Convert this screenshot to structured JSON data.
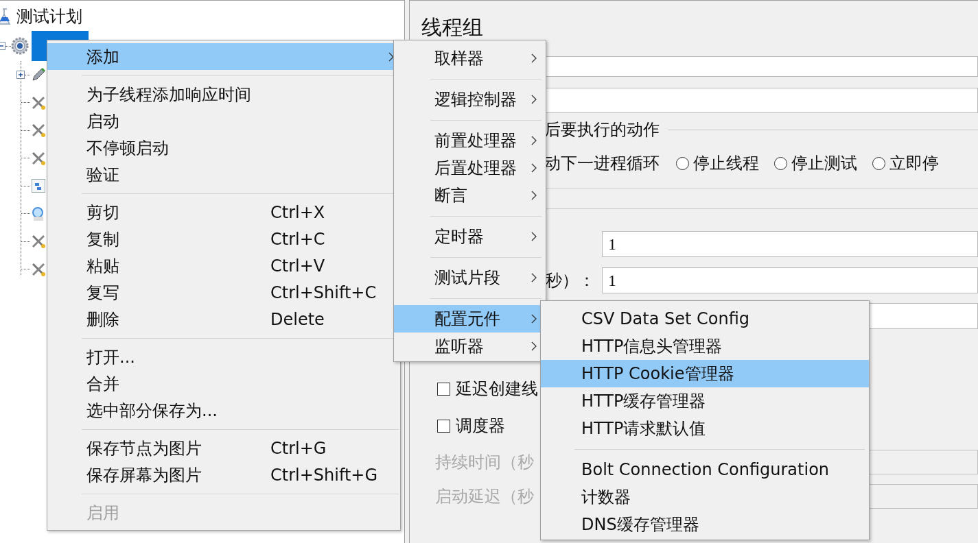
{
  "tree": {
    "root": {
      "label": "测试计划"
    },
    "node": {
      "selected": true,
      "expanded": true
    },
    "children": [
      {
        "kind": "script",
        "has_children": true
      },
      {
        "kind": "tool",
        "has_children": false
      },
      {
        "kind": "tool",
        "has_children": false
      },
      {
        "kind": "tool",
        "has_children": false
      },
      {
        "kind": "table",
        "has_children": false
      },
      {
        "kind": "magnifier",
        "has_children": false
      },
      {
        "kind": "tool",
        "has_children": false
      },
      {
        "kind": "tool",
        "has_children": false
      }
    ]
  },
  "panel": {
    "title": "线程组",
    "error_action": {
      "legend": "后要执行的动作",
      "cut_option_label": "动下一进程循环",
      "options": [
        {
          "label": "停止线程",
          "selected": false
        },
        {
          "label": "停止测试",
          "selected": false
        },
        {
          "label": "立即停",
          "selected": false
        }
      ]
    },
    "thread_fields": [
      {
        "value": "1"
      },
      {
        "label": "秒）：",
        "value": "1"
      }
    ],
    "checkboxes": [
      {
        "label": "延迟创建线",
        "checked": false
      },
      {
        "label": "调度器",
        "checked": false
      }
    ],
    "disabled_fields": [
      {
        "label": "持续时间（秒",
        "disabled": true
      },
      {
        "label": "启动延迟（秒",
        "disabled": true
      }
    ]
  },
  "context_menu": {
    "groups": [
      [
        {
          "label": "添加",
          "has_submenu": true,
          "selected": true,
          "disabled": false
        }
      ],
      [
        {
          "label": "为子线程添加响应时间",
          "selected": false,
          "disabled": false
        },
        {
          "label": "启动",
          "selected": false,
          "disabled": false
        },
        {
          "label": "不停顿启动",
          "selected": false,
          "disabled": false
        },
        {
          "label": "验证",
          "selected": false,
          "disabled": false
        }
      ],
      [
        {
          "label": "剪切",
          "shortcut": "Ctrl+X",
          "selected": false,
          "disabled": false
        },
        {
          "label": "复制",
          "shortcut": "Ctrl+C",
          "selected": false,
          "disabled": false
        },
        {
          "label": "粘贴",
          "shortcut": "Ctrl+V",
          "selected": false,
          "disabled": false
        },
        {
          "label": "复写",
          "shortcut": "Ctrl+Shift+C",
          "selected": false,
          "disabled": false
        },
        {
          "label": "删除",
          "shortcut": "Delete",
          "selected": false,
          "disabled": false
        }
      ],
      [
        {
          "label": "打开...",
          "selected": false,
          "disabled": false
        },
        {
          "label": "合并",
          "selected": false,
          "disabled": false
        },
        {
          "label": "选中部分保存为...",
          "selected": false,
          "disabled": false
        }
      ],
      [
        {
          "label": "保存节点为图片",
          "shortcut": "Ctrl+G",
          "selected": false,
          "disabled": false
        },
        {
          "label": "保存屏幕为图片",
          "shortcut": "Ctrl+Shift+G",
          "selected": false,
          "disabled": false
        }
      ],
      [
        {
          "label": "启用",
          "selected": false,
          "disabled": true
        }
      ]
    ]
  },
  "add_submenu": {
    "groups": [
      [
        {
          "label": "取样器",
          "has_submenu": true,
          "selected": false
        }
      ],
      [
        {
          "label": "逻辑控制器",
          "has_submenu": true,
          "selected": false
        }
      ],
      [
        {
          "label": "前置处理器",
          "has_submenu": true,
          "selected": false
        },
        {
          "label": "后置处理器",
          "has_submenu": true,
          "selected": false
        },
        {
          "label": "断言",
          "has_submenu": true,
          "selected": false
        }
      ],
      [
        {
          "label": "定时器",
          "has_submenu": true,
          "selected": false
        }
      ],
      [
        {
          "label": "测试片段",
          "has_submenu": true,
          "selected": false
        }
      ],
      [
        {
          "label": "配置元件",
          "has_submenu": true,
          "selected": true
        },
        {
          "label": "监听器",
          "has_submenu": true,
          "selected": false
        }
      ]
    ]
  },
  "config_submenu": {
    "groups": [
      [
        {
          "label": "CSV Data Set Config",
          "selected": false
        },
        {
          "label": "HTTP信息头管理器",
          "selected": false
        },
        {
          "label": "HTTP Cookie管理器",
          "selected": true
        },
        {
          "label": "HTTP缓存管理器",
          "selected": false
        },
        {
          "label": "HTTP请求默认值",
          "selected": false
        }
      ],
      [
        {
          "label": "Bolt Connection Configuration",
          "selected": false
        },
        {
          "label": "计数器",
          "selected": false
        },
        {
          "label": "DNS缓存管理器",
          "selected": false
        }
      ]
    ]
  }
}
